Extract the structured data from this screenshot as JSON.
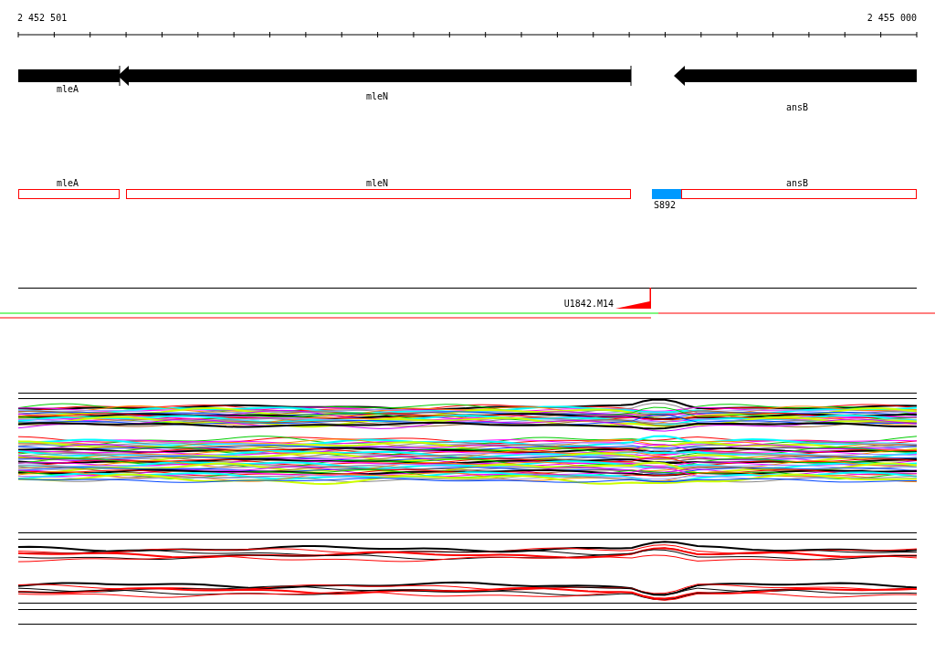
{
  "ruler": {
    "start_label": "2 452 501",
    "end_label": "2 455 000"
  },
  "genes": [
    {
      "kind": "bar",
      "label": "mleA"
    },
    {
      "kind": "arrow",
      "label": "mleN"
    },
    {
      "kind": "arrow",
      "label": "ansB"
    }
  ],
  "features": [
    {
      "kind": "gene",
      "label": "mleA"
    },
    {
      "kind": "gene",
      "label": "mleN"
    },
    {
      "kind": "site",
      "label": "S892"
    },
    {
      "kind": "gene",
      "label": "ansB"
    }
  ],
  "probe": {
    "label": "U1842.M14"
  }
}
